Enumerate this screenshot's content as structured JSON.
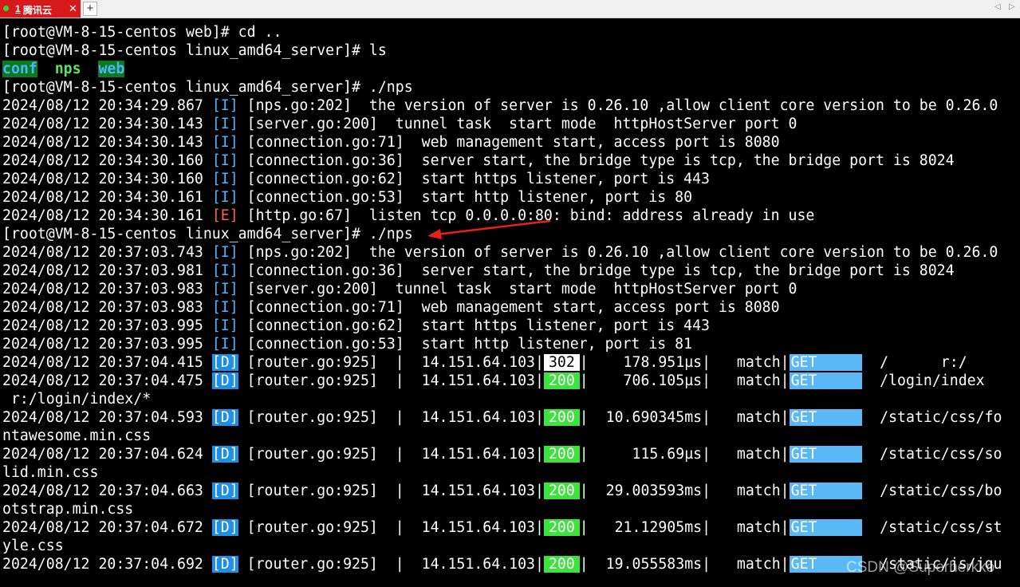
{
  "tab": {
    "number": "1",
    "title": "腾讯云",
    "close": "✕",
    "add": "+",
    "nav_left": "◁",
    "nav_right": "▷"
  },
  "terminal": {
    "prompt_web": "[root@VM-8-15-centos web]# cd ..",
    "prompt_ls": "[root@VM-8-15-centos linux_amd64_server]# ls",
    "ls": {
      "conf": "conf",
      "nps": "nps",
      "web": "web"
    },
    "prompt_nps1": "[root@VM-8-15-centos linux_amd64_server]# ./nps",
    "run1": [
      {
        "ts": "2024/08/12 20:34:29.867",
        "lvl": "[I]",
        "msg": "[nps.go:202]  the version of server is 0.26.10 ,allow client core version to be 0.26.0"
      },
      {
        "ts": "2024/08/12 20:34:30.143",
        "lvl": "[I]",
        "msg": "[server.go:200]  tunnel task  start mode  httpHostServer port 0"
      },
      {
        "ts": "2024/08/12 20:34:30.143",
        "lvl": "[I]",
        "msg": "[connection.go:71]  web management start, access port is 8080"
      },
      {
        "ts": "2024/08/12 20:34:30.160",
        "lvl": "[I]",
        "msg": "[connection.go:36]  server start, the bridge type is tcp, the bridge port is 8024"
      },
      {
        "ts": "2024/08/12 20:34:30.160",
        "lvl": "[I]",
        "msg": "[connection.go:62]  start https listener, port is 443"
      },
      {
        "ts": "2024/08/12 20:34:30.161",
        "lvl": "[I]",
        "msg": "[connection.go:53]  start http listener, port is 80"
      },
      {
        "ts": "2024/08/12 20:34:30.161",
        "lvl": "[E]",
        "msg": "[http.go:67]  listen tcp 0.0.0.0:80: bind: address already in use"
      }
    ],
    "prompt_nps2": "[root@VM-8-15-centos linux_amd64_server]# ./nps",
    "run2": [
      {
        "ts": "2024/08/12 20:37:03.743",
        "lvl": "[I]",
        "msg": "[nps.go:202]  the version of server is 0.26.10 ,allow client core version to be 0.26.0"
      },
      {
        "ts": "2024/08/12 20:37:03.981",
        "lvl": "[I]",
        "msg": "[connection.go:36]  server start, the bridge type is tcp, the bridge port is 8024"
      },
      {
        "ts": "2024/08/12 20:37:03.983",
        "lvl": "[I]",
        "msg": "[server.go:200]  tunnel task  start mode  httpHostServer port 0"
      },
      {
        "ts": "2024/08/12 20:37:03.983",
        "lvl": "[I]",
        "msg": "[connection.go:71]  web management start, access port is 8080"
      },
      {
        "ts": "2024/08/12 20:37:03.995",
        "lvl": "[I]",
        "msg": "[connection.go:62]  start https listener, port is 443"
      },
      {
        "ts": "2024/08/12 20:37:03.995",
        "lvl": "[I]",
        "msg": "[connection.go:53]  start http listener, port is 81"
      }
    ],
    "requests": [
      {
        "ts": "2024/08/12 20:37:04.415",
        "lvl": "[D]",
        "src": "[router.go:925]",
        "ip": "14.151.64.103",
        "status": "302",
        "dur": "178.951µs",
        "match": "match",
        "method": "GET",
        "path": "/      r:/",
        "wrap": ""
      },
      {
        "ts": "2024/08/12 20:37:04.475",
        "lvl": "[D]",
        "src": "[router.go:925]",
        "ip": "14.151.64.103",
        "status": "200",
        "dur": "706.105µs",
        "match": "match",
        "method": "GET",
        "path": "/login/index",
        "wrap": " r:/login/index/*"
      },
      {
        "ts": "2024/08/12 20:37:04.593",
        "lvl": "[D]",
        "src": "[router.go:925]",
        "ip": "14.151.64.103",
        "status": "200",
        "dur": "10.690345ms",
        "match": "match",
        "method": "GET",
        "path": "/static/css/fo",
        "wrap": "ntawesome.min.css"
      },
      {
        "ts": "2024/08/12 20:37:04.624",
        "lvl": "[D]",
        "src": "[router.go:925]",
        "ip": "14.151.64.103",
        "status": "200",
        "dur": "115.69µs",
        "match": "match",
        "method": "GET",
        "path": "/static/css/so",
        "wrap": "lid.min.css"
      },
      {
        "ts": "2024/08/12 20:37:04.663",
        "lvl": "[D]",
        "src": "[router.go:925]",
        "ip": "14.151.64.103",
        "status": "200",
        "dur": "29.003593ms",
        "match": "match",
        "method": "GET",
        "path": "/static/css/bo",
        "wrap": "otstrap.min.css"
      },
      {
        "ts": "2024/08/12 20:37:04.672",
        "lvl": "[D]",
        "src": "[router.go:925]",
        "ip": "14.151.64.103",
        "status": "200",
        "dur": "21.12905ms",
        "match": "match",
        "method": "GET",
        "path": "/static/css/st",
        "wrap": "yle.css"
      },
      {
        "ts": "2024/08/12 20:37:04.692",
        "lvl": "[D]",
        "src": "[router.go:925]",
        "ip": "14.151.64.103",
        "status": "200",
        "dur": "19.055583ms",
        "match": "match",
        "method": "GET",
        "path": "/static/js/jqu",
        "wrap": ""
      }
    ]
  },
  "watermark": "CSDN @Superherkko",
  "colors": {
    "info": "#4db4ff",
    "error": "#ff5f5f",
    "debug_bg": "#1f8fe6",
    "status_ok_bg": "#3ee23e",
    "method_bg": "#59b8f5",
    "annotation_arrow": "#e8211c"
  }
}
